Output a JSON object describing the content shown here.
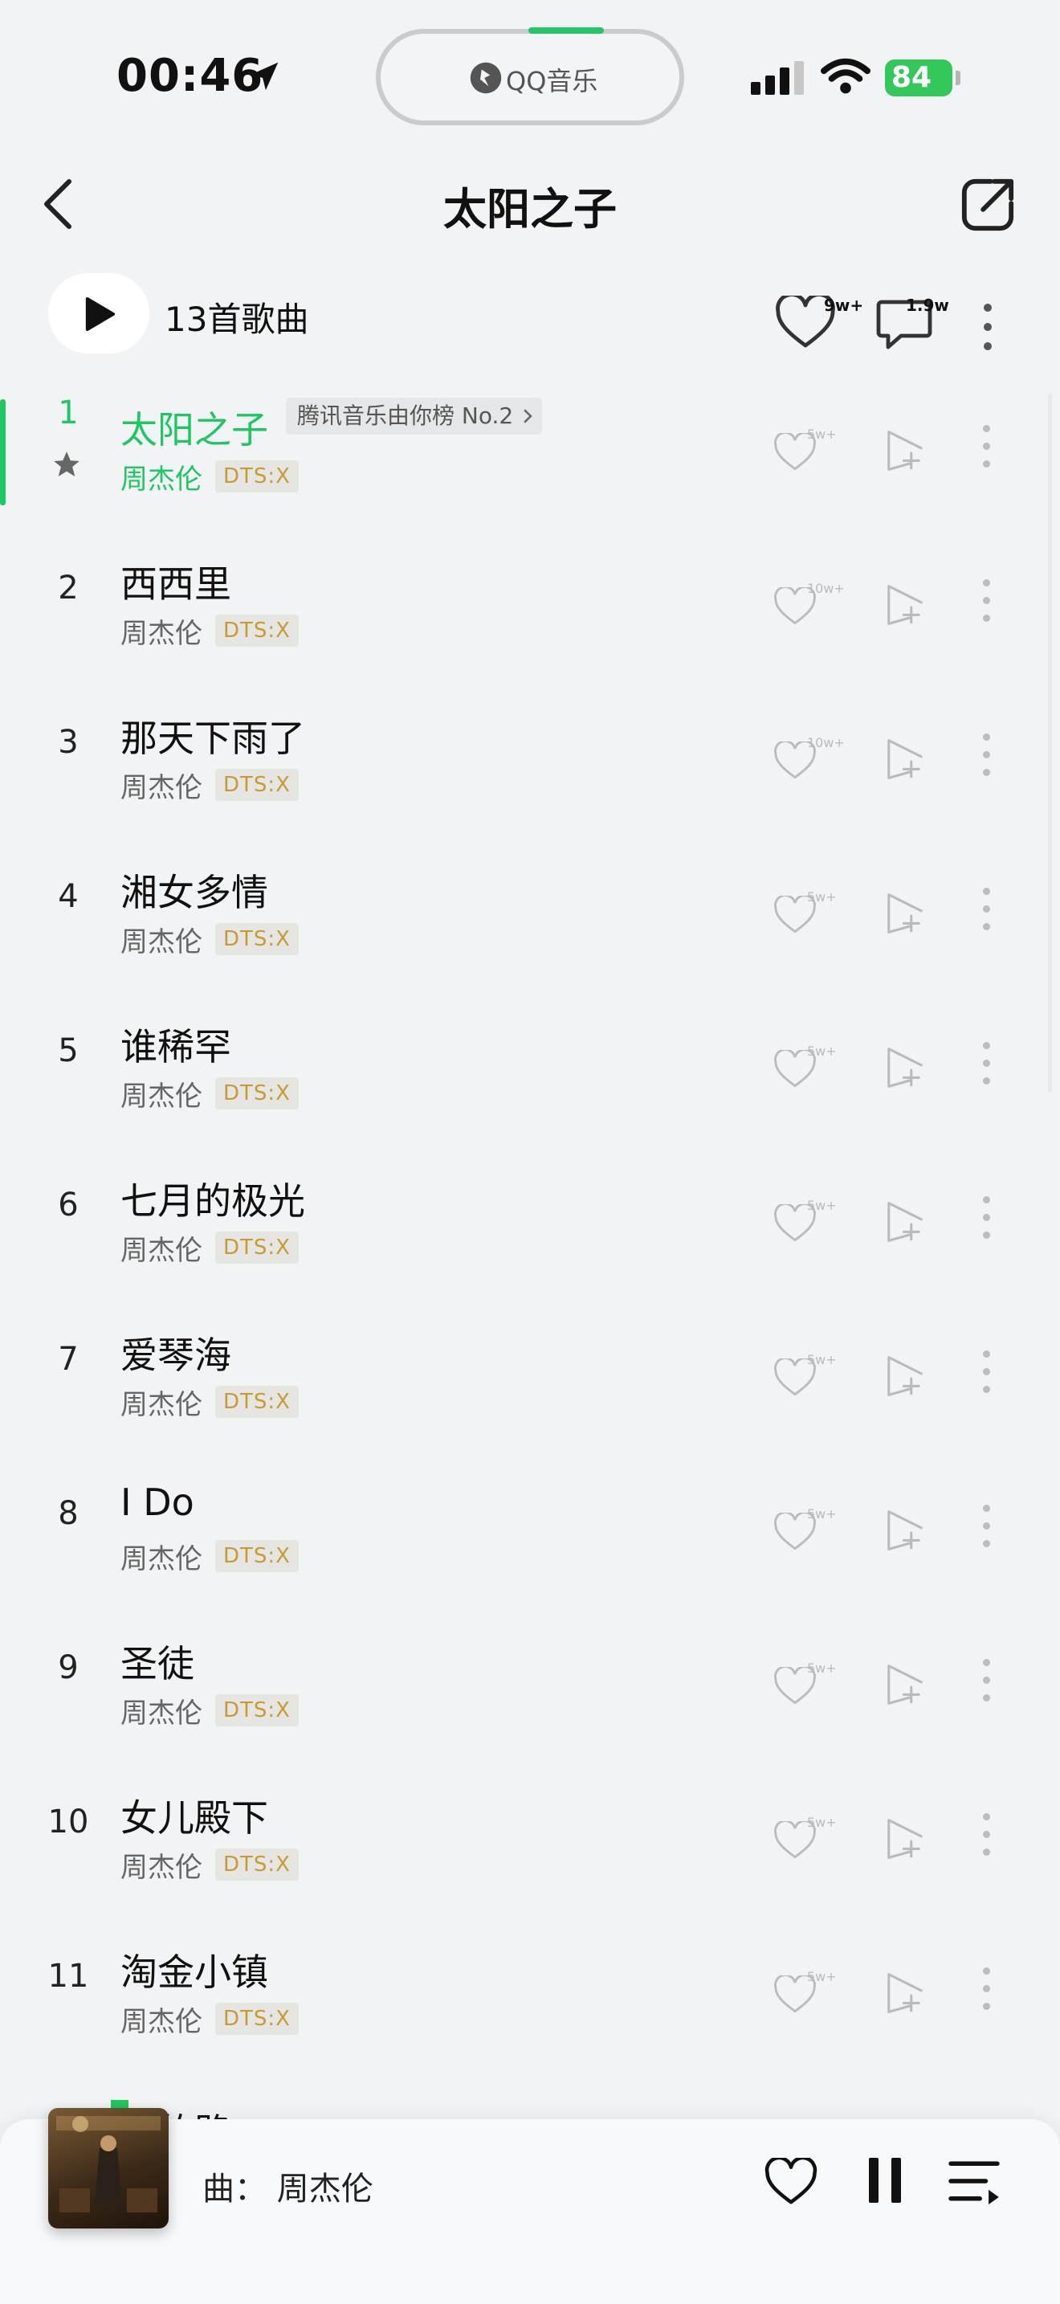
{
  "status_bar": {
    "time": "00:46",
    "island_text": "QQ音乐",
    "battery": "84"
  },
  "header": {
    "title": "太阳之子"
  },
  "toolbar": {
    "song_count": "13首歌曲",
    "favorite_count": "9w+",
    "comment_count": "1.9w"
  },
  "songs": [
    {
      "num": "1",
      "title": "太阳之子",
      "artist": "周杰伦",
      "quality": "DTS:X",
      "likes": "5w+",
      "tag": "腾讯音乐由你榜 No.2"
    },
    {
      "num": "2",
      "title": "西西里",
      "artist": "周杰伦",
      "quality": "DTS:X",
      "likes": "10w+"
    },
    {
      "num": "3",
      "title": "那天下雨了",
      "artist": "周杰伦",
      "quality": "DTS:X",
      "likes": "10w+"
    },
    {
      "num": "4",
      "title": "湘女多情",
      "artist": "周杰伦",
      "quality": "DTS:X",
      "likes": "5w+"
    },
    {
      "num": "5",
      "title": "谁稀罕",
      "artist": "周杰伦",
      "quality": "DTS:X",
      "likes": "5w+"
    },
    {
      "num": "6",
      "title": "七月的极光",
      "artist": "周杰伦",
      "quality": "DTS:X",
      "likes": "5w+"
    },
    {
      "num": "7",
      "title": "爱琴海",
      "artist": "周杰伦",
      "quality": "DTS:X",
      "likes": "5w+"
    },
    {
      "num": "8",
      "title": "I Do",
      "artist": "周杰伦",
      "quality": "DTS:X",
      "likes": "5w+"
    },
    {
      "num": "9",
      "title": "圣徒",
      "artist": "周杰伦",
      "quality": "DTS:X",
      "likes": "5w+"
    },
    {
      "num": "10",
      "title": "女儿殿下",
      "artist": "周杰伦",
      "quality": "DTS:X",
      "likes": "5w+"
    },
    {
      "num": "11",
      "title": "淘金小镇",
      "artist": "周杰伦",
      "quality": "DTS:X",
      "likes": "5w+"
    }
  ],
  "partial_row_title": "绕的路",
  "mini_player": {
    "now_playing": "曲：  周杰伦"
  },
  "colors": {
    "accent": "#1fc762",
    "background": "#f1f3f5",
    "dts_text": "#c99a33"
  },
  "icons": [
    "location-arrow-icon",
    "qq-music-logo-icon",
    "signal-icon",
    "wifi-icon",
    "back-icon",
    "share-icon",
    "play-icon",
    "heart-icon",
    "comment-icon",
    "more-icon",
    "star-icon",
    "chevron-right-icon",
    "add-to-playlist-icon",
    "pause-icon",
    "playlist-icon"
  ]
}
